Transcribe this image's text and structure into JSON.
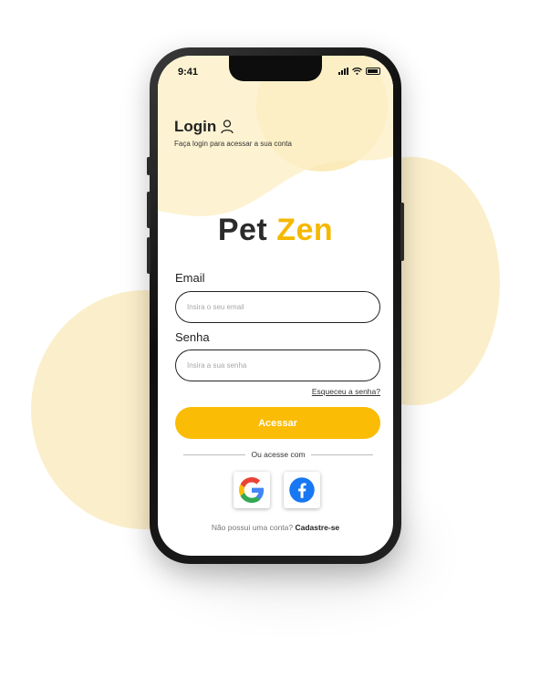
{
  "status_bar": {
    "time": "9:41"
  },
  "header": {
    "title": "Login",
    "subtitle": "Faça login para acessar a sua conta"
  },
  "brand": {
    "word1": "Pet",
    "word2": "Zen"
  },
  "form": {
    "email_label": "Email",
    "email_placeholder": "Insira o seu email",
    "password_label": "Senha",
    "password_placeholder": "Insira a sua senha",
    "forgot_link": "Esqueceu a senha?",
    "submit_label": "Acessar"
  },
  "social": {
    "divider_text": "Ou acesse com",
    "providers": [
      {
        "name": "google",
        "icon": "google-icon"
      },
      {
        "name": "facebook",
        "icon": "facebook-icon"
      }
    ]
  },
  "footer": {
    "question": "Não possui uma conta?",
    "signup_link": "Cadastre-se"
  },
  "colors": {
    "accent": "#fbbc05",
    "brand_yellow": "#f5b800",
    "background_blob": "#fbefcb",
    "dark_text": "#2b2b2b"
  }
}
